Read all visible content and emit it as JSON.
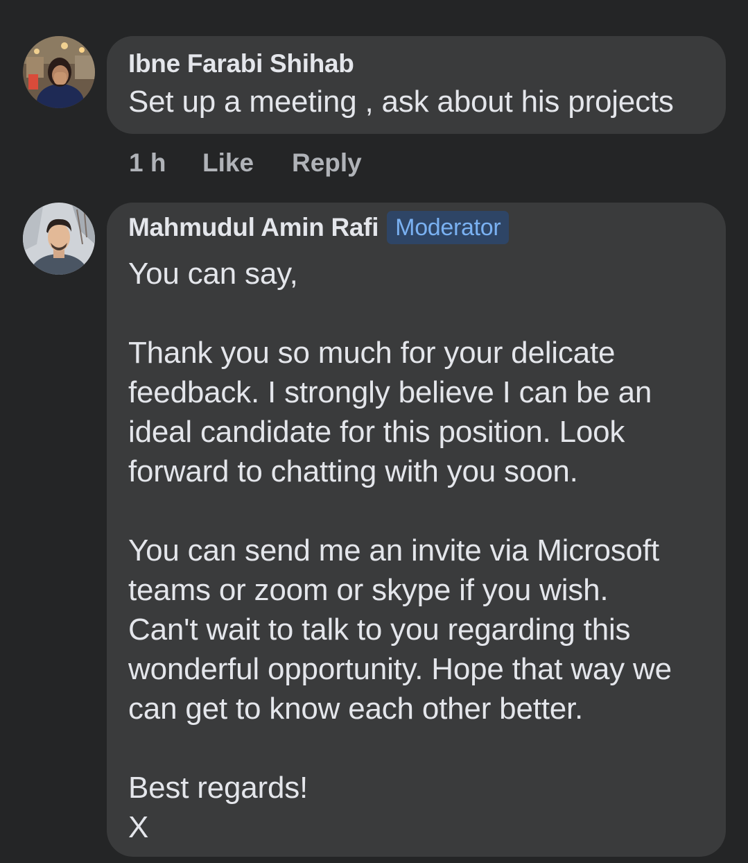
{
  "comments": [
    {
      "author": "Ibne Farabi Shihab",
      "text": "Set up a meeting , ask about his projects",
      "time": "1 h",
      "like_label": "Like",
      "reply_label": "Reply"
    },
    {
      "author": "Mahmudul Amin Rafi",
      "badge": "Moderator",
      "text": "You can say,\n\nThank you so much for your delicate\nfeedback.  I strongly believe I can be an\nideal candidate for this position. Look\nforward to chatting with you soon.\n\nYou can send me an invite via Microsoft\nteams or zoom or skype if you wish.\nCan't wait to talk to you regarding this\nwonderful opportunity. Hope that way we\ncan get to know each other better.\n\nBest regards!\nX"
    }
  ],
  "colors": {
    "background": "#242526",
    "bubble": "#3a3b3c",
    "text": "#e4e6eb",
    "secondary_text": "#b0b3b8",
    "badge_bg": "#2e4566",
    "badge_text": "#7ab1f2"
  }
}
